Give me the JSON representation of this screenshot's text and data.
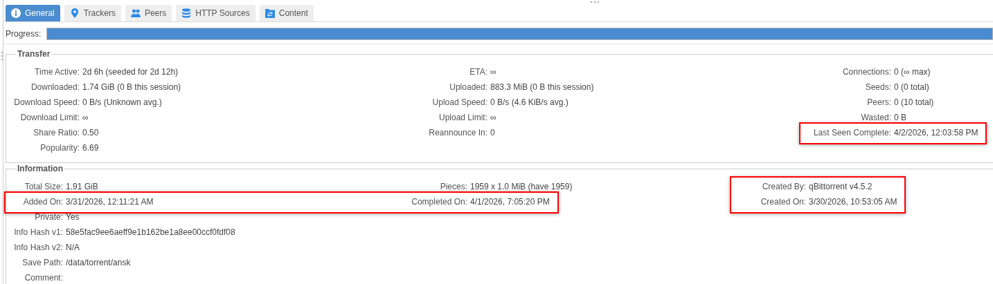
{
  "tabs": [
    {
      "label": "General",
      "selected": true
    },
    {
      "label": "Trackers",
      "selected": false
    },
    {
      "label": "Peers",
      "selected": false
    },
    {
      "label": "HTTP Sources",
      "selected": false
    },
    {
      "label": "Content",
      "selected": false
    }
  ],
  "progress": {
    "label": "Progress:",
    "level": 1
  },
  "sections": [
    {
      "kind": "transfer",
      "title": "Transfer",
      "columns": [
        [
          {
            "label": "Time Active:",
            "value": "2d 6h (seeded for 2d 12h)",
            "highlighted": false
          },
          {
            "label": "Downloaded:",
            "value": "1.74 GiB (0 B this session)",
            "highlighted": false
          },
          {
            "label": "Download Speed:",
            "value": "0 B/s (Unknown avg.)",
            "highlighted": false
          },
          {
            "label": "Download Limit:",
            "value": "∞",
            "highlighted": false
          },
          {
            "label": "Share Ratio:",
            "value": "0.50",
            "highlighted": false
          },
          {
            "label": "Popularity:",
            "value": "6.69",
            "highlighted": false
          }
        ],
        [
          {
            "label": "ETA:",
            "value": "∞",
            "highlighted": false
          },
          {
            "label": "Uploaded:",
            "value": "883.3 MiB (0 B this session)",
            "highlighted": false
          },
          {
            "label": "Upload Speed:",
            "value": "0 B/s (4.6 KiB/s avg.)",
            "highlighted": false
          },
          {
            "label": "Upload Limit:",
            "value": "∞",
            "highlighted": false
          },
          {
            "label": "Reannounce In:",
            "value": "0",
            "highlighted": false
          }
        ],
        [
          {
            "label": "Connections:",
            "value": "0 (∞ max)",
            "highlighted": false
          },
          {
            "label": "Seeds:",
            "value": "0 (0 total)",
            "highlighted": false
          },
          {
            "label": "Peers:",
            "value": "0 (10 total)",
            "highlighted": false
          },
          {
            "label": "Wasted:",
            "value": "0 B",
            "highlighted": false
          },
          {
            "label": "Last Seen Complete:",
            "value": "4/2/2026, 12:03:58 PM",
            "highlighted": true
          }
        ]
      ]
    },
    {
      "kind": "information",
      "title": "Information",
      "columns": [
        [
          {
            "label": "Total Size:",
            "value": "1.91 GiB",
            "highlighted": false
          },
          {
            "label": "Added On:",
            "value": "3/31/2026, 12:11:21 AM",
            "highlighted": true
          },
          {
            "label": "Private:",
            "value": "Yes",
            "highlighted": false
          },
          {
            "label": "Info Hash v1:",
            "value": "58e5fac9ee6aeff9e1b162be1a8ee00ccf0fdf08",
            "highlighted": false
          },
          {
            "label": "Info Hash v2:",
            "value": "N/A",
            "highlighted": false
          },
          {
            "label": "Save Path:",
            "value": "/data/torrent/ansk",
            "highlighted": false
          },
          {
            "label": "Comment:",
            "highlighted": false
          }
        ],
        [
          {
            "label": "Pieces:",
            "value": "1959 x 1.0 MiB (have 1959)",
            "highlighted": false
          },
          {
            "label": "Completed On:",
            "value": "4/1/2026, 7:05:20 PM",
            "highlighted": true
          }
        ],
        [
          {
            "label": "Created By:",
            "value": "qBittorrent v4.5.2",
            "highlighted": true
          },
          {
            "label": "Created On:",
            "value": "3/30/2026, 10:53:05 AM",
            "highlighted": true
          }
        ]
      ]
    }
  ]
}
